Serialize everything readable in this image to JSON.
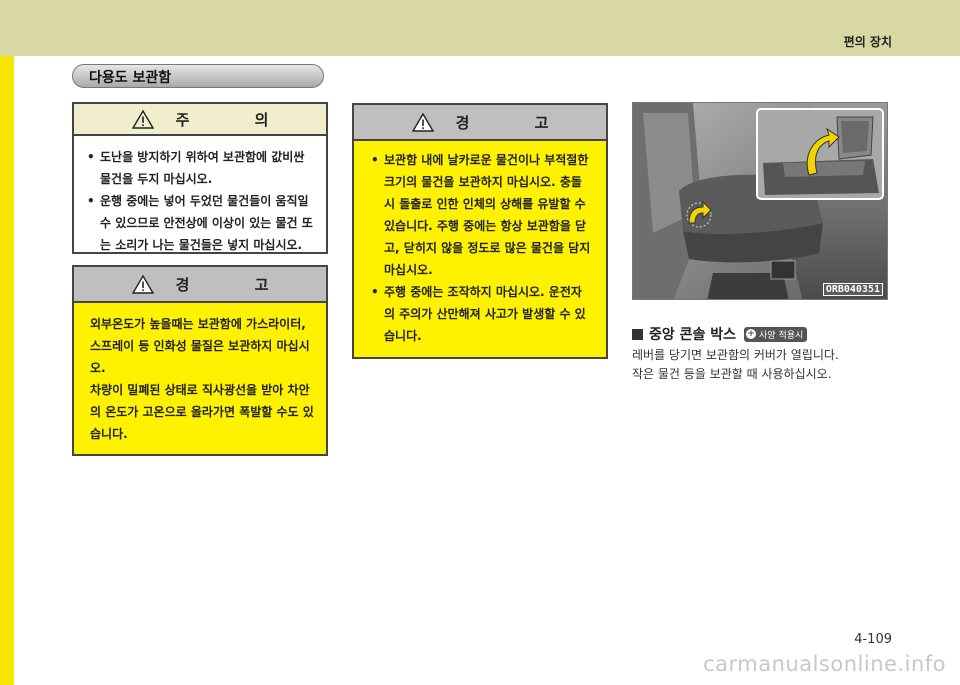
{
  "header": {
    "section_label": "편의 장치"
  },
  "title": "다용도 보관함",
  "caution": {
    "heading": "주 의",
    "items": [
      "도난을 방지하기 위하여 보관함에 값비싼 물건을 두지 마십시오.",
      "운행 중에는 넣어 두었던 물건들이 움직일 수 있으므로 안전상에 이상이 있는 물건 또는 소리가 나는 물건들은 넣지 마십시오."
    ]
  },
  "warning_left": {
    "heading": "경 고",
    "paragraphs": [
      "외부온도가 높을때는 보관함에 가스라이터, 스프레이 등 인화성 물질은 보관하지 마십시오.",
      "차량이 밀폐된 상태로 직사광선을 받아 차안의 온도가 고온으로 올라가면 폭발할 수도 있습니다."
    ]
  },
  "warning_middle": {
    "heading": "경 고",
    "items": [
      "보관함 내에 날카로운 물건이나 부적절한 크기의 물건을 보관하지 마십시오. 충돌시 돌출로 인한 인체의 상해를 유발할 수 있습니다. 주행 중에는 항상 보관함을 닫고, 닫히지 않을 정도로 많은 물건을 담지 마십시오.",
      "주행 중에는 조작하지 마십시오. 운전자의 주의가 산만해져 사고가 발생할 수 있습니다."
    ]
  },
  "figure": {
    "code": "ORB040351",
    "caption_title": "중앙 콘솔 박스",
    "option_badge": "사양 적용시",
    "description": [
      "레버를 당기면 보관함의 커버가 열립니다.",
      "작은 물건 등을 보관할 때 사용하십시오."
    ]
  },
  "footer": {
    "page_number": "4-109"
  },
  "watermark": "carmanualsonline.info",
  "colors": {
    "header_band": "#d8d8a4",
    "accent_yellow": "#fff200",
    "warning_head": "#bfbfbf"
  },
  "icons": [
    "warning-triangle-icon",
    "plus-circle-icon",
    "arrow-icon"
  ]
}
